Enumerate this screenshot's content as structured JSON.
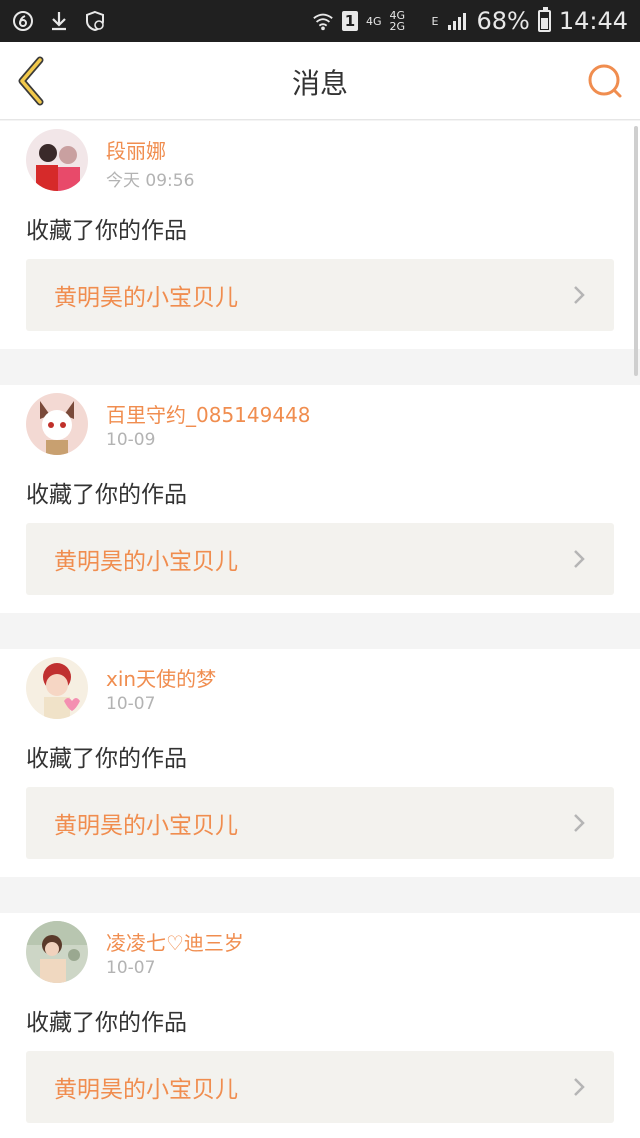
{
  "status_bar": {
    "network_4g": "4G",
    "network_4g2g": "4G 2G",
    "network_e": "E",
    "sim": "1",
    "battery": "68%",
    "time": "14:44",
    "battery_level": 0.68
  },
  "header": {
    "title": "消息",
    "accent": "#f08d4f"
  },
  "messages": [
    {
      "username": "段丽娜",
      "time": "今天 09:56",
      "action": "收藏了你的作品",
      "work": "黄明昊的小宝贝儿"
    },
    {
      "username": "百里守约_085149448",
      "time": "10-09",
      "action": "收藏了你的作品",
      "work": "黄明昊的小宝贝儿"
    },
    {
      "username": "xin天使的梦",
      "time": "10-07",
      "action": "收藏了你的作品",
      "work": "黄明昊的小宝贝儿"
    },
    {
      "username": "凌凌七♡迪三岁",
      "time": "10-07",
      "action": "收藏了你的作品",
      "work": "黄明昊的小宝贝儿"
    }
  ]
}
